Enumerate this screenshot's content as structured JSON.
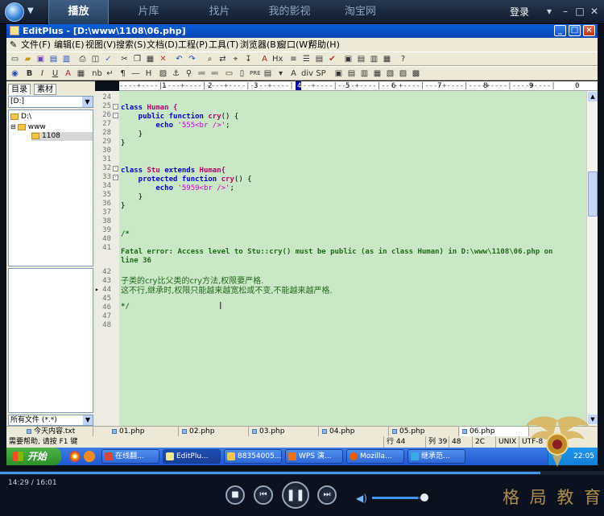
{
  "player": {
    "tabs": [
      "播放",
      "片库",
      "找片",
      "我的影视",
      "淘宝网"
    ],
    "login": "登录",
    "time": "14:29 / 16:01",
    "progress": 0.895,
    "volume": 0.86,
    "watermark": "格 局 教 育"
  },
  "window": {
    "title": "EditPlus - [D:\\www\\1108\\06.php]",
    "menu": [
      "文件(F)",
      "编辑(E)",
      "视图(V)",
      "搜索(S)",
      "文档(D)",
      "工程(P)",
      "工具(T)",
      "浏览器(B)",
      "窗口(W)",
      "帮助(H)"
    ]
  },
  "left_panel": {
    "tabs": [
      "目录",
      "素材"
    ],
    "drive": "[D:]",
    "tree": [
      "D:\\",
      "www",
      "1108"
    ],
    "filter": "所有文件 (*.*)"
  },
  "ruler": {
    "numbers": [
      "1",
      "2",
      "3",
      "4",
      "5",
      "6",
      "7",
      "8",
      "9",
      "0"
    ]
  },
  "editor": {
    "line_numbers": [
      "24",
      "25",
      "26",
      "27",
      "28",
      "29",
      "30",
      "31",
      "32",
      "33",
      "34",
      "35",
      "36",
      "37",
      "38",
      "39",
      "40",
      "41",
      "",
      "42",
      "43",
      "44",
      "45",
      "46",
      "47",
      "48"
    ],
    "code": {
      "l25_kw": "class",
      "l25_name": " Human {",
      "l26_kw": "    public function",
      "l26_fn": " cry",
      "l26_rest": "() {",
      "l27_kw": "        echo",
      "l27_str": " '555<br />'",
      "l27_rest": ";",
      "l28": "    }",
      "l29": "}",
      "l32_kw": "class",
      "l32_name": " Stu",
      "l32_kw2": " extends",
      "l32_rest": " Human{",
      "l33_kw": "    protected function",
      "l33_fn": " cry",
      "l33_rest": "() {",
      "l34_kw": "        echo",
      "l34_str": " '5959<br />'",
      "l34_rest": ";",
      "l35": "    }",
      "l36": "}",
      "l39": "/*",
      "l41a": "Fatal error: Access level to Stu::cry() must be public (as in class Human) in D:\\www\\1108\\06.php on",
      "l41b": "line 36",
      "l43": "子类的cry比父类的cry方法,权限要严格.",
      "l44": "这不行,继承时,权限只能越来越宽松或不变,不能越来越严格.",
      "l46": "*/"
    }
  },
  "file_tabs": [
    "今天内容.txt",
    "01.php",
    "02.php",
    "03.php",
    "04.php",
    "05.php",
    "06.php"
  ],
  "status": {
    "help": "需要帮助, 请按 F1 键",
    "line": "行 44",
    "col": "列 39",
    "n1": "48",
    "n2": "2C",
    "enc": "UNIX",
    "charset": "UTF-8"
  },
  "taskbar": {
    "start": "开始",
    "tasks": [
      "在线翻...",
      "EditPlu...",
      "88354005...",
      "WPS 演...",
      "Mozilla...",
      "继承范..."
    ],
    "clock": "22:05"
  }
}
